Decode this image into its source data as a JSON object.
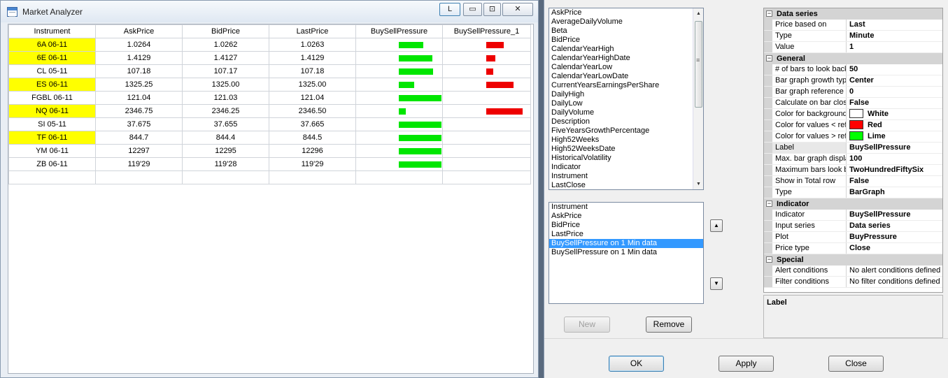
{
  "window": {
    "title": "Market Analyzer",
    "buttons": {
      "lock": "L",
      "minimize": "▭",
      "maximize": "⊡",
      "close": "✕"
    }
  },
  "grid": {
    "columns": [
      "Instrument",
      "AskPrice",
      "BidPrice",
      "LastPrice",
      "BuySellPressure",
      "BuySellPressure_1"
    ],
    "highlight_color": "#ffff00",
    "rows": [
      {
        "instrument": "6A 06-11",
        "ask": "1.0264",
        "bid": "1.0262",
        "last": "1.0263",
        "highlight": true,
        "buy_pressure": 0.56,
        "sell_pressure": 0.45
      },
      {
        "instrument": "6E 06-11",
        "ask": "1.4129",
        "bid": "1.4127",
        "last": "1.4129",
        "highlight": true,
        "buy_pressure": 0.77,
        "sell_pressure": 0.23
      },
      {
        "instrument": "CL 05-11",
        "ask": "107.18",
        "bid": "107.17",
        "last": "107.18",
        "highlight": false,
        "buy_pressure": 0.79,
        "sell_pressure": 0.19
      },
      {
        "instrument": "ES 06-11",
        "ask": "1325.25",
        "bid": "1325.00",
        "last": "1325.00",
        "highlight": true,
        "buy_pressure": 0.35,
        "sell_pressure": 0.7
      },
      {
        "instrument": "FGBL 06-11",
        "ask": "121.04",
        "bid": "121.03",
        "last": "121.04",
        "highlight": false,
        "buy_pressure": 0.98,
        "sell_pressure": 0
      },
      {
        "instrument": "NQ 06-11",
        "ask": "2346.75",
        "bid": "2346.25",
        "last": "2346.50",
        "highlight": true,
        "buy_pressure": 0.16,
        "sell_pressure": 0.95
      },
      {
        "instrument": "SI 05-11",
        "ask": "37.675",
        "bid": "37.655",
        "last": "37.665",
        "highlight": false,
        "buy_pressure": 0.98,
        "sell_pressure": 0
      },
      {
        "instrument": "TF 06-11",
        "ask": "844.7",
        "bid": "844.4",
        "last": "844.5",
        "highlight": true,
        "buy_pressure": 0.98,
        "sell_pressure": 0
      },
      {
        "instrument": "YM 06-11",
        "ask": "12297",
        "bid": "12295",
        "last": "12296",
        "highlight": false,
        "buy_pressure": 0.98,
        "sell_pressure": 0
      },
      {
        "instrument": "ZB 06-11",
        "ask": "119'29",
        "bid": "119'28",
        "last": "119'29",
        "highlight": false,
        "buy_pressure": 0.98,
        "sell_pressure": 0
      }
    ],
    "bar_colors": {
      "buy": "#00e600",
      "sell": "#ee0000"
    }
  },
  "available_columns": [
    "AskPrice",
    "AverageDailyVolume",
    "Beta",
    "BidPrice",
    "CalendarYearHigh",
    "CalendarYearHighDate",
    "CalendarYearLow",
    "CalendarYearLowDate",
    "CurrentYearsEarningsPerShare",
    "DailyHigh",
    "DailyLow",
    "DailyVolume",
    "Description",
    "FiveYearsGrowthPercentage",
    "High52Weeks",
    "High52WeeksDate",
    "HistoricalVolatility",
    "Indicator",
    "Instrument",
    "LastClose"
  ],
  "selected_columns": {
    "items": [
      "Instrument",
      "AskPrice",
      "BidPrice",
      "LastPrice",
      "BuySellPressure on 1 Min data",
      "BuySellPressure on 1 Min data"
    ],
    "selected_index": 4
  },
  "buttons": {
    "move_up": "▲",
    "move_down": "▼",
    "new": "New",
    "remove": "Remove",
    "ok": "OK",
    "apply": "Apply",
    "close": "Close"
  },
  "properties": {
    "categories": [
      {
        "title": "Data series",
        "toggle": "⊟",
        "rows": [
          {
            "name": "Price based on",
            "value": "Last"
          },
          {
            "name": "Type",
            "value": "Minute"
          },
          {
            "name": "Value",
            "value": "1"
          }
        ]
      },
      {
        "title": "General",
        "toggle": "⊟",
        "rows": [
          {
            "name": "# of bars to look back",
            "value": "50"
          },
          {
            "name": "Bar graph growth type",
            "value": "Center"
          },
          {
            "name": "Bar graph reference value",
            "value": "0"
          },
          {
            "name": "Calculate on bar close",
            "value": "False"
          },
          {
            "name": "Color for background",
            "value": "White",
            "swatch": "#ffffff"
          },
          {
            "name": "Color for values < reference",
            "value": "Red",
            "swatch": "#ff0000"
          },
          {
            "name": "Color for values > reference",
            "value": "Lime",
            "swatch": "#00ff00"
          },
          {
            "name": "Label",
            "value": "BuySellPressure",
            "selected": true
          },
          {
            "name": "Max. bar graph display",
            "value": "100"
          },
          {
            "name": "Maximum bars look back",
            "value": "TwoHundredFiftySix"
          },
          {
            "name": "Show in Total row",
            "value": "False"
          },
          {
            "name": "Type",
            "value": "BarGraph"
          }
        ]
      },
      {
        "title": "Indicator",
        "toggle": "⊟",
        "rows": [
          {
            "name": "Indicator",
            "value": "BuySellPressure"
          },
          {
            "name": "Input series",
            "value": "Data series"
          },
          {
            "name": "Plot",
            "value": "BuyPressure"
          },
          {
            "name": "Price type",
            "value": "Close"
          }
        ]
      },
      {
        "title": "Special",
        "toggle": "⊟",
        "rows": [
          {
            "name": "Alert conditions",
            "value": "No alert conditions defined",
            "normal": true
          },
          {
            "name": "Filter conditions",
            "value": "No filter conditions defined",
            "normal": true
          }
        ]
      }
    ],
    "description_title": "Label"
  }
}
